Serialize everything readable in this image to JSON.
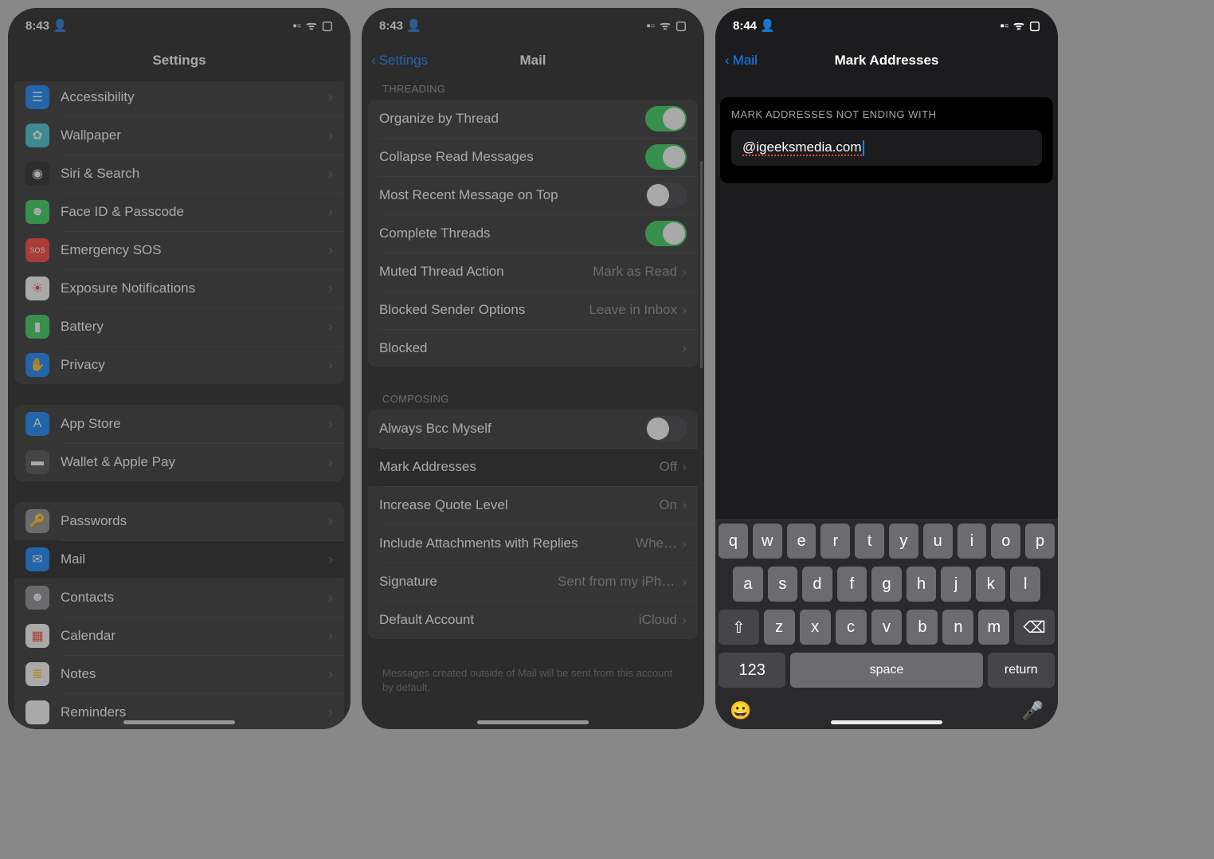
{
  "screen1": {
    "time": "8:43",
    "title": "Settings",
    "groups": [
      {
        "rows": [
          {
            "icon_bg": "#0a84ff",
            "glyph": "☰",
            "label": "Accessibility"
          },
          {
            "icon_bg": "#38c8d4",
            "glyph": "✿",
            "label": "Wallpaper"
          },
          {
            "icon_bg": "#1c1c1e",
            "glyph": "◉",
            "label": "Siri & Search"
          },
          {
            "icon_bg": "#30d158",
            "glyph": "☻",
            "label": "Face ID & Passcode"
          },
          {
            "icon_bg": "#ff3b30",
            "glyph": "SOS",
            "label": "Emergency SOS",
            "small": true
          },
          {
            "icon_bg": "#ffffff",
            "glyph": "☀",
            "fg": "#ff3b30",
            "label": "Exposure Notifications"
          },
          {
            "icon_bg": "#30d158",
            "glyph": "▮",
            "label": "Battery"
          },
          {
            "icon_bg": "#0a84ff",
            "glyph": "✋",
            "label": "Privacy"
          }
        ]
      },
      {
        "rows": [
          {
            "icon_bg": "#0a84ff",
            "glyph": "A",
            "label": "App Store"
          },
          {
            "icon_bg": "#4a4a4e",
            "glyph": "▬",
            "label": "Wallet & Apple Pay"
          }
        ]
      },
      {
        "rows": [
          {
            "icon_bg": "#8e8e93",
            "glyph": "🔑",
            "label": "Passwords"
          },
          {
            "icon_bg": "#0a84ff",
            "glyph": "✉",
            "label": "Mail",
            "highlight": true
          },
          {
            "icon_bg": "#8e8e93",
            "glyph": "☻",
            "label": "Contacts"
          },
          {
            "icon_bg": "#ffffff",
            "glyph": "▦",
            "fg": "#ff3b30",
            "label": "Calendar"
          },
          {
            "icon_bg": "#ffffff",
            "glyph": "≣",
            "fg": "#ffcc00",
            "label": "Notes"
          },
          {
            "icon_bg": "#ffffff",
            "glyph": "☑",
            "label": "Reminders"
          }
        ]
      }
    ]
  },
  "screen2": {
    "time": "8:43",
    "back": "Settings",
    "title": "Mail",
    "threading_header": "THREADING",
    "threading": [
      {
        "label": "Organize by Thread",
        "toggle": true
      },
      {
        "label": "Collapse Read Messages",
        "toggle": true
      },
      {
        "label": "Most Recent Message on Top",
        "toggle": false
      },
      {
        "label": "Complete Threads",
        "toggle": true
      },
      {
        "label": "Muted Thread Action",
        "trail": "Mark as Read",
        "chevron": true
      },
      {
        "label": "Blocked Sender Options",
        "trail": "Leave in Inbox",
        "chevron": true
      },
      {
        "label": "Blocked",
        "chevron": true
      }
    ],
    "composing_header": "COMPOSING",
    "composing": [
      {
        "label": "Always Bcc Myself",
        "toggle": false
      },
      {
        "label": "Mark Addresses",
        "trail": "Off",
        "chevron": true,
        "highlight": true
      },
      {
        "label": "Increase Quote Level",
        "trail": "On",
        "chevron": true
      },
      {
        "label": "Include Attachments with Replies",
        "trail": "Whe…",
        "chevron": true
      },
      {
        "label": "Signature",
        "trail": "Sent from my iPhone",
        "chevron": true
      },
      {
        "label": "Default Account",
        "trail": "iCloud",
        "chevron": true
      }
    ],
    "footer": "Messages created outside of Mail will be sent from this account by default."
  },
  "screen3": {
    "time": "8:44",
    "back": "Mail",
    "title": "Mark Addresses",
    "section_label": "MARK ADDRESSES NOT ENDING WITH",
    "input_value": "@igeeksmedia.com",
    "keyboard": {
      "row1": [
        "q",
        "w",
        "e",
        "r",
        "t",
        "y",
        "u",
        "i",
        "o",
        "p"
      ],
      "row2": [
        "a",
        "s",
        "d",
        "f",
        "g",
        "h",
        "j",
        "k",
        "l"
      ],
      "row3": [
        "z",
        "x",
        "c",
        "v",
        "b",
        "n",
        "m"
      ],
      "num": "123",
      "space": "space",
      "return": "return"
    }
  },
  "status_icons": {
    "signal": "▪▫",
    "wifi": "ᯤ",
    "battery": "▢"
  }
}
